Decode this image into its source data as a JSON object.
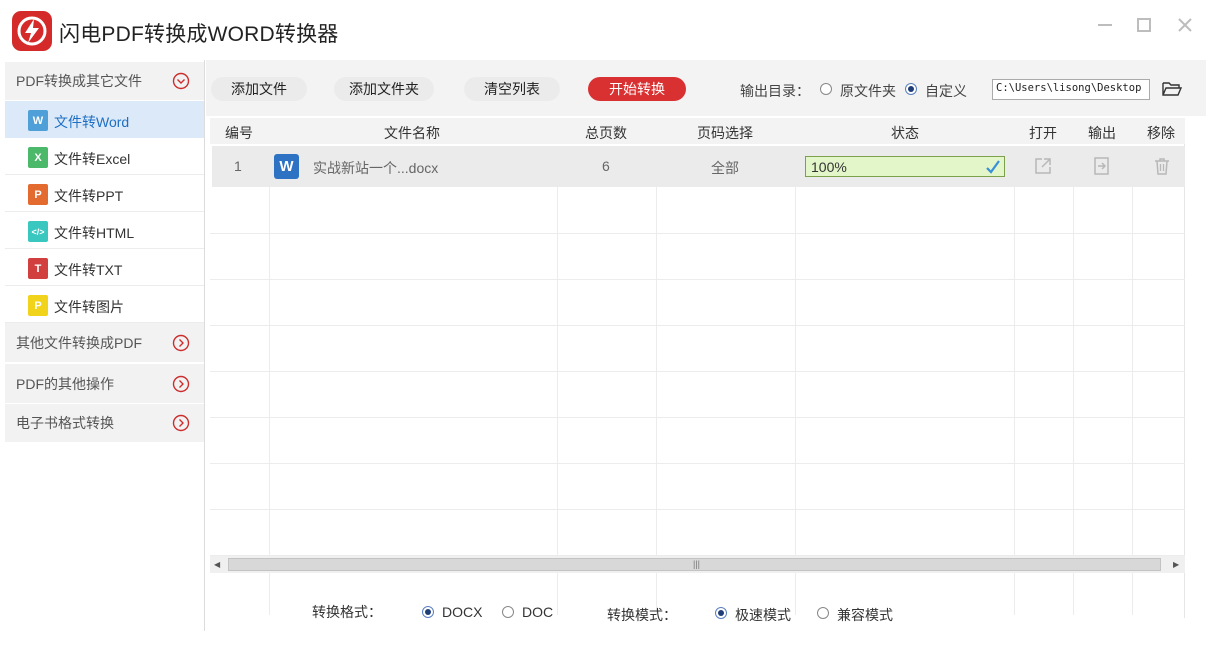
{
  "app": {
    "title": "闪电PDF转换成WORD转换器",
    "accent_color": "#d93131"
  },
  "sidebar": {
    "groups": [
      {
        "label": "PDF转换成其它文件",
        "expanded": true,
        "items": [
          {
            "label": "文件转Word",
            "icon": "word-file-icon",
            "icon_text": "W",
            "color": "#4fa0d8",
            "active": true
          },
          {
            "label": "文件转Excel",
            "icon": "excel-file-icon",
            "icon_text": "X",
            "color": "#4cb86a",
            "active": false
          },
          {
            "label": "文件转PPT",
            "icon": "ppt-file-icon",
            "icon_text": "P",
            "color": "#e36b2f",
            "active": false
          },
          {
            "label": "文件转HTML",
            "icon": "html-file-icon",
            "icon_text": "</>",
            "color": "#39c7c0",
            "active": false
          },
          {
            "label": "文件转TXT",
            "icon": "txt-file-icon",
            "icon_text": "T",
            "color": "#d13f3f",
            "active": false
          },
          {
            "label": "文件转图片",
            "icon": "image-file-icon",
            "icon_text": "P",
            "color": "#f2d31c",
            "active": false
          }
        ]
      },
      {
        "label": "其他文件转换成PDF",
        "expanded": false
      },
      {
        "label": "PDF的其他操作",
        "expanded": false
      },
      {
        "label": "电子书格式转换",
        "expanded": false
      }
    ]
  },
  "toolbar": {
    "add_file": "添加文件",
    "add_folder": "添加文件夹",
    "clear_list": "清空列表",
    "start_convert": "开始转换",
    "output_dir_label": "输出目录：",
    "output_options": [
      {
        "label": "原文件夹",
        "selected": false
      },
      {
        "label": "自定义",
        "selected": true
      }
    ],
    "output_path": "C:\\Users\\lisong\\Desktop"
  },
  "table": {
    "columns": [
      "编号",
      "文件名称",
      "总页数",
      "页码选择",
      "状态",
      "打开",
      "输出",
      "移除"
    ],
    "rows": [
      {
        "index": "1",
        "file_icon": "W",
        "file_name": "实战新站一个...docx",
        "pages": "6",
        "page_selection": "全部",
        "status": "100%",
        "progress": 1.0
      }
    ]
  },
  "options": {
    "format_label": "转换格式：",
    "formats": [
      {
        "label": "DOCX",
        "selected": true
      },
      {
        "label": "DOC",
        "selected": false
      }
    ],
    "mode_label": "转换模式：",
    "modes": [
      {
        "label": "极速模式",
        "selected": true
      },
      {
        "label": "兼容模式",
        "selected": false
      }
    ]
  }
}
